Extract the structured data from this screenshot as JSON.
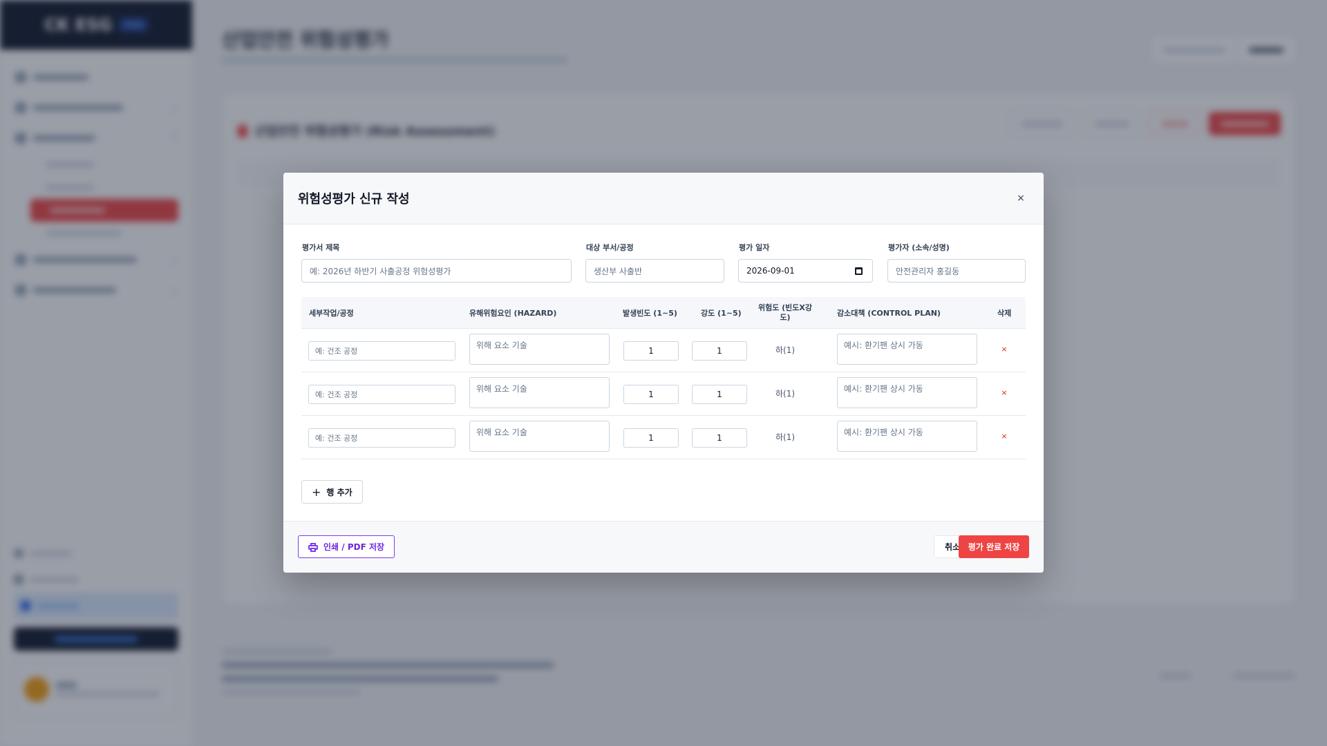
{
  "modal": {
    "title": "위험성평가 신규 작성",
    "close_icon": "×",
    "fields": {
      "title_label": "평가서 제목",
      "title_placeholder": "예: 2026년 하반기 사출공정 위험성평가",
      "dept_label": "대상 부서/공정",
      "dept_value": "생산부 사출반",
      "date_label": "평가 일자",
      "date_value": "2026-09-01",
      "assessor_label": "평가자 (소속/성명)",
      "assessor_value": "안전관리자 홍길동"
    },
    "table": {
      "headers": {
        "task": "세부작업/공정",
        "hazard": "유해위험요인 (HAZARD)",
        "frequency": "발생빈도 (1~5)",
        "severity": "강도 (1~5)",
        "risk": "위험도 (빈도X강도)",
        "control": "감소대책 (CONTROL PLAN)",
        "delete": "삭제"
      },
      "rows": [
        {
          "task": "예: 건조 공정",
          "hazard": "위해 요소 기술",
          "frequency": "1",
          "severity": "1",
          "risk": "하(1)",
          "control": "예시: 환기팬 상시 가동",
          "delete": "×"
        },
        {
          "task": "예: 건조 공정",
          "hazard": "위해 요소 기술",
          "frequency": "1",
          "severity": "1",
          "risk": "하(1)",
          "control": "예시: 환기팬 상시 가동",
          "delete": "×"
        },
        {
          "task": "예: 건조 공정",
          "hazard": "위해 요소 기술",
          "frequency": "1",
          "severity": "1",
          "risk": "하(1)",
          "control": "예시: 환기팬 상시 가동",
          "delete": "×"
        }
      ]
    },
    "add_row_label": "행 추가",
    "add_row_icon": "+",
    "print_label": "인쇄 / PDF 저장",
    "cancel_label": "취소",
    "save_label": "평가 완료 저장"
  },
  "background": {
    "logo": "CK ESG",
    "logo_tag": "CKA",
    "page_title": "산업안전 위험성평가",
    "card_title": "산업안전 위험성평가 (Risk Assessment)"
  },
  "colors": {
    "accent_red": "#ef4444",
    "print_purple": "#7c3aed",
    "overlay": "rgba(30,41,59,0.45)"
  }
}
